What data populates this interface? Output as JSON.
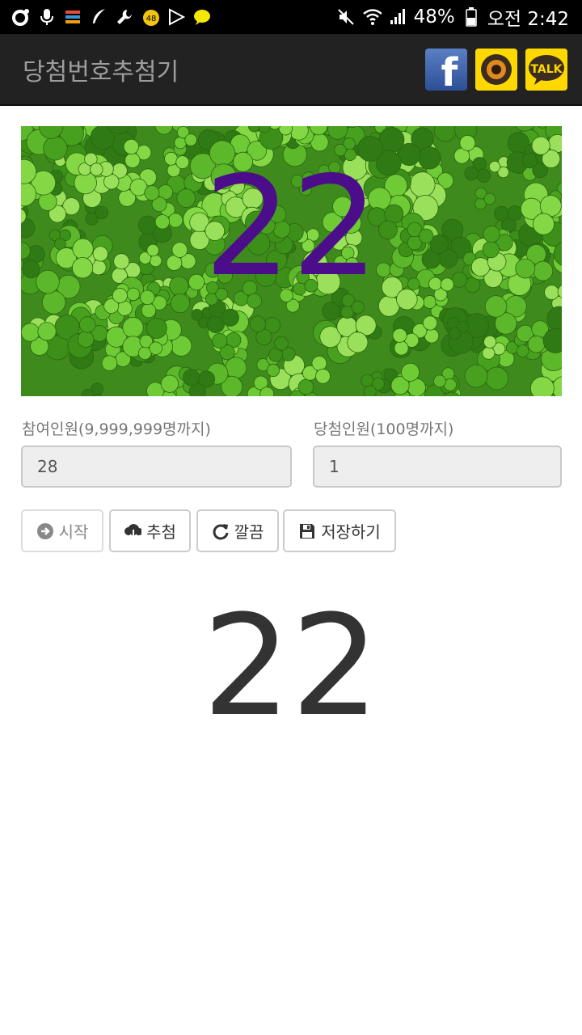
{
  "status_bar": {
    "battery": "48%",
    "time": "오전 2:42",
    "notification_badge": "48"
  },
  "app_bar": {
    "title": "당첨번호추첨기",
    "share": {
      "facebook_label": "f",
      "kakaotalk_label": "TALK"
    }
  },
  "banner": {
    "number": "22"
  },
  "form": {
    "participants_label": "참여인원(9,999,999명까지)",
    "participants_value": "28",
    "winners_label": "당첨인원(100명까지)",
    "winners_value": "1"
  },
  "buttons": {
    "start": "시작",
    "draw": "추첨",
    "clear": "깔끔",
    "save": "저장하기"
  },
  "result": {
    "number": "22"
  },
  "colors": {
    "app_bar_bg": "#222222",
    "banner_number": "#4b0d8a",
    "result_number": "#333333"
  }
}
